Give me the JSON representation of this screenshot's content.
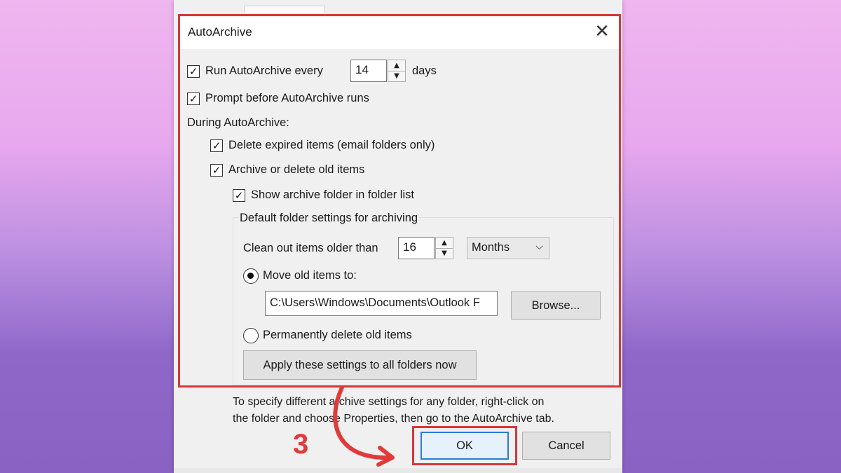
{
  "dialog": {
    "title": "AutoArchive",
    "close_glyph": "✕",
    "run_every": {
      "label": "Run AutoArchive every",
      "value": "14",
      "unit": "days",
      "checked": true
    },
    "prompt_before": {
      "label": "Prompt before AutoArchive runs",
      "checked": true
    },
    "during_label": "During AutoArchive:",
    "delete_expired": {
      "label": "Delete expired items (email folders only)",
      "checked": true
    },
    "archive_old": {
      "label": "Archive or delete old items",
      "checked": true
    },
    "show_archive_folder": {
      "label": "Show archive folder in folder list",
      "checked": true
    },
    "default_settings": {
      "legend": "Default folder settings for archiving",
      "clean_out_label": "Clean out items older than",
      "clean_out_value": "16",
      "period_selected": "Months",
      "move_old_label": "Move old items to:",
      "move_path": "C:\\Users\\Windows\\Documents\\Outlook F",
      "browse_label": "Browse...",
      "delete_permanently_label": "Permanently delete old items",
      "apply_all_label": "Apply these settings to all folders now"
    },
    "hint_line1": "To specify different archive settings for any folder, right-click on",
    "hint_line2": "the folder and choose Properties, then go to the AutoArchive tab.",
    "ok_label": "OK",
    "cancel_label": "Cancel"
  },
  "annotation": {
    "step_number": "3",
    "highlight_color": "#d8363a"
  },
  "icons": {
    "check": "✓",
    "spin_up": "▲",
    "spin_down": "▼",
    "chevron_down": "⌵"
  }
}
